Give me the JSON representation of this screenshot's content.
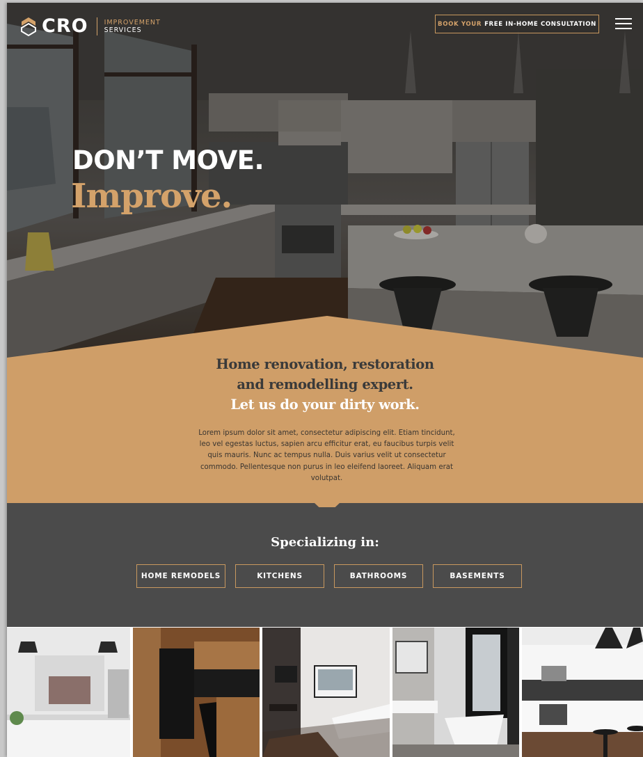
{
  "brand": {
    "logo_word": "CRO",
    "sub_line1": "IMPROVEMENT",
    "sub_line2": "SERVICES",
    "accent": "#d4a26a",
    "tan": "#cf9e68",
    "dark": "#4b4b4b"
  },
  "header": {
    "cta_gold": "BOOK YOUR",
    "cta_rest": "FREE IN-HOME CONSULTATION",
    "menu_icon": "hamburger-menu-icon"
  },
  "hero": {
    "line1": "DON’T MOVE.",
    "line2": "Improve."
  },
  "intro": {
    "tag1": "Home renovation, restoration",
    "tag2": "and remodelling expert.",
    "tag3": "Let us do your dirty work.",
    "body": "Lorem ipsum dolor sit amet, consectetur adipiscing elit. Etiam tincidunt, leo vel egestas luctus, sapien arcu efficitur erat, eu faucibus turpis velit quis mauris. Nunc ac tempus nulla. Duis varius velit ut consectetur commodo. Pellentesque non purus in leo eleifend laoreet. Aliquam erat volutpat."
  },
  "specializing": {
    "title": "Specializing in:",
    "items": [
      "HOME REMODELS",
      "KITCHENS",
      "BATHROOMS",
      "BASEMENTS"
    ]
  },
  "gallery": {
    "images": [
      "kitchen-white-photo",
      "kitchen-wood-photo",
      "living-room-photo",
      "bathroom-photo",
      "kitchen-modern-photo"
    ]
  }
}
